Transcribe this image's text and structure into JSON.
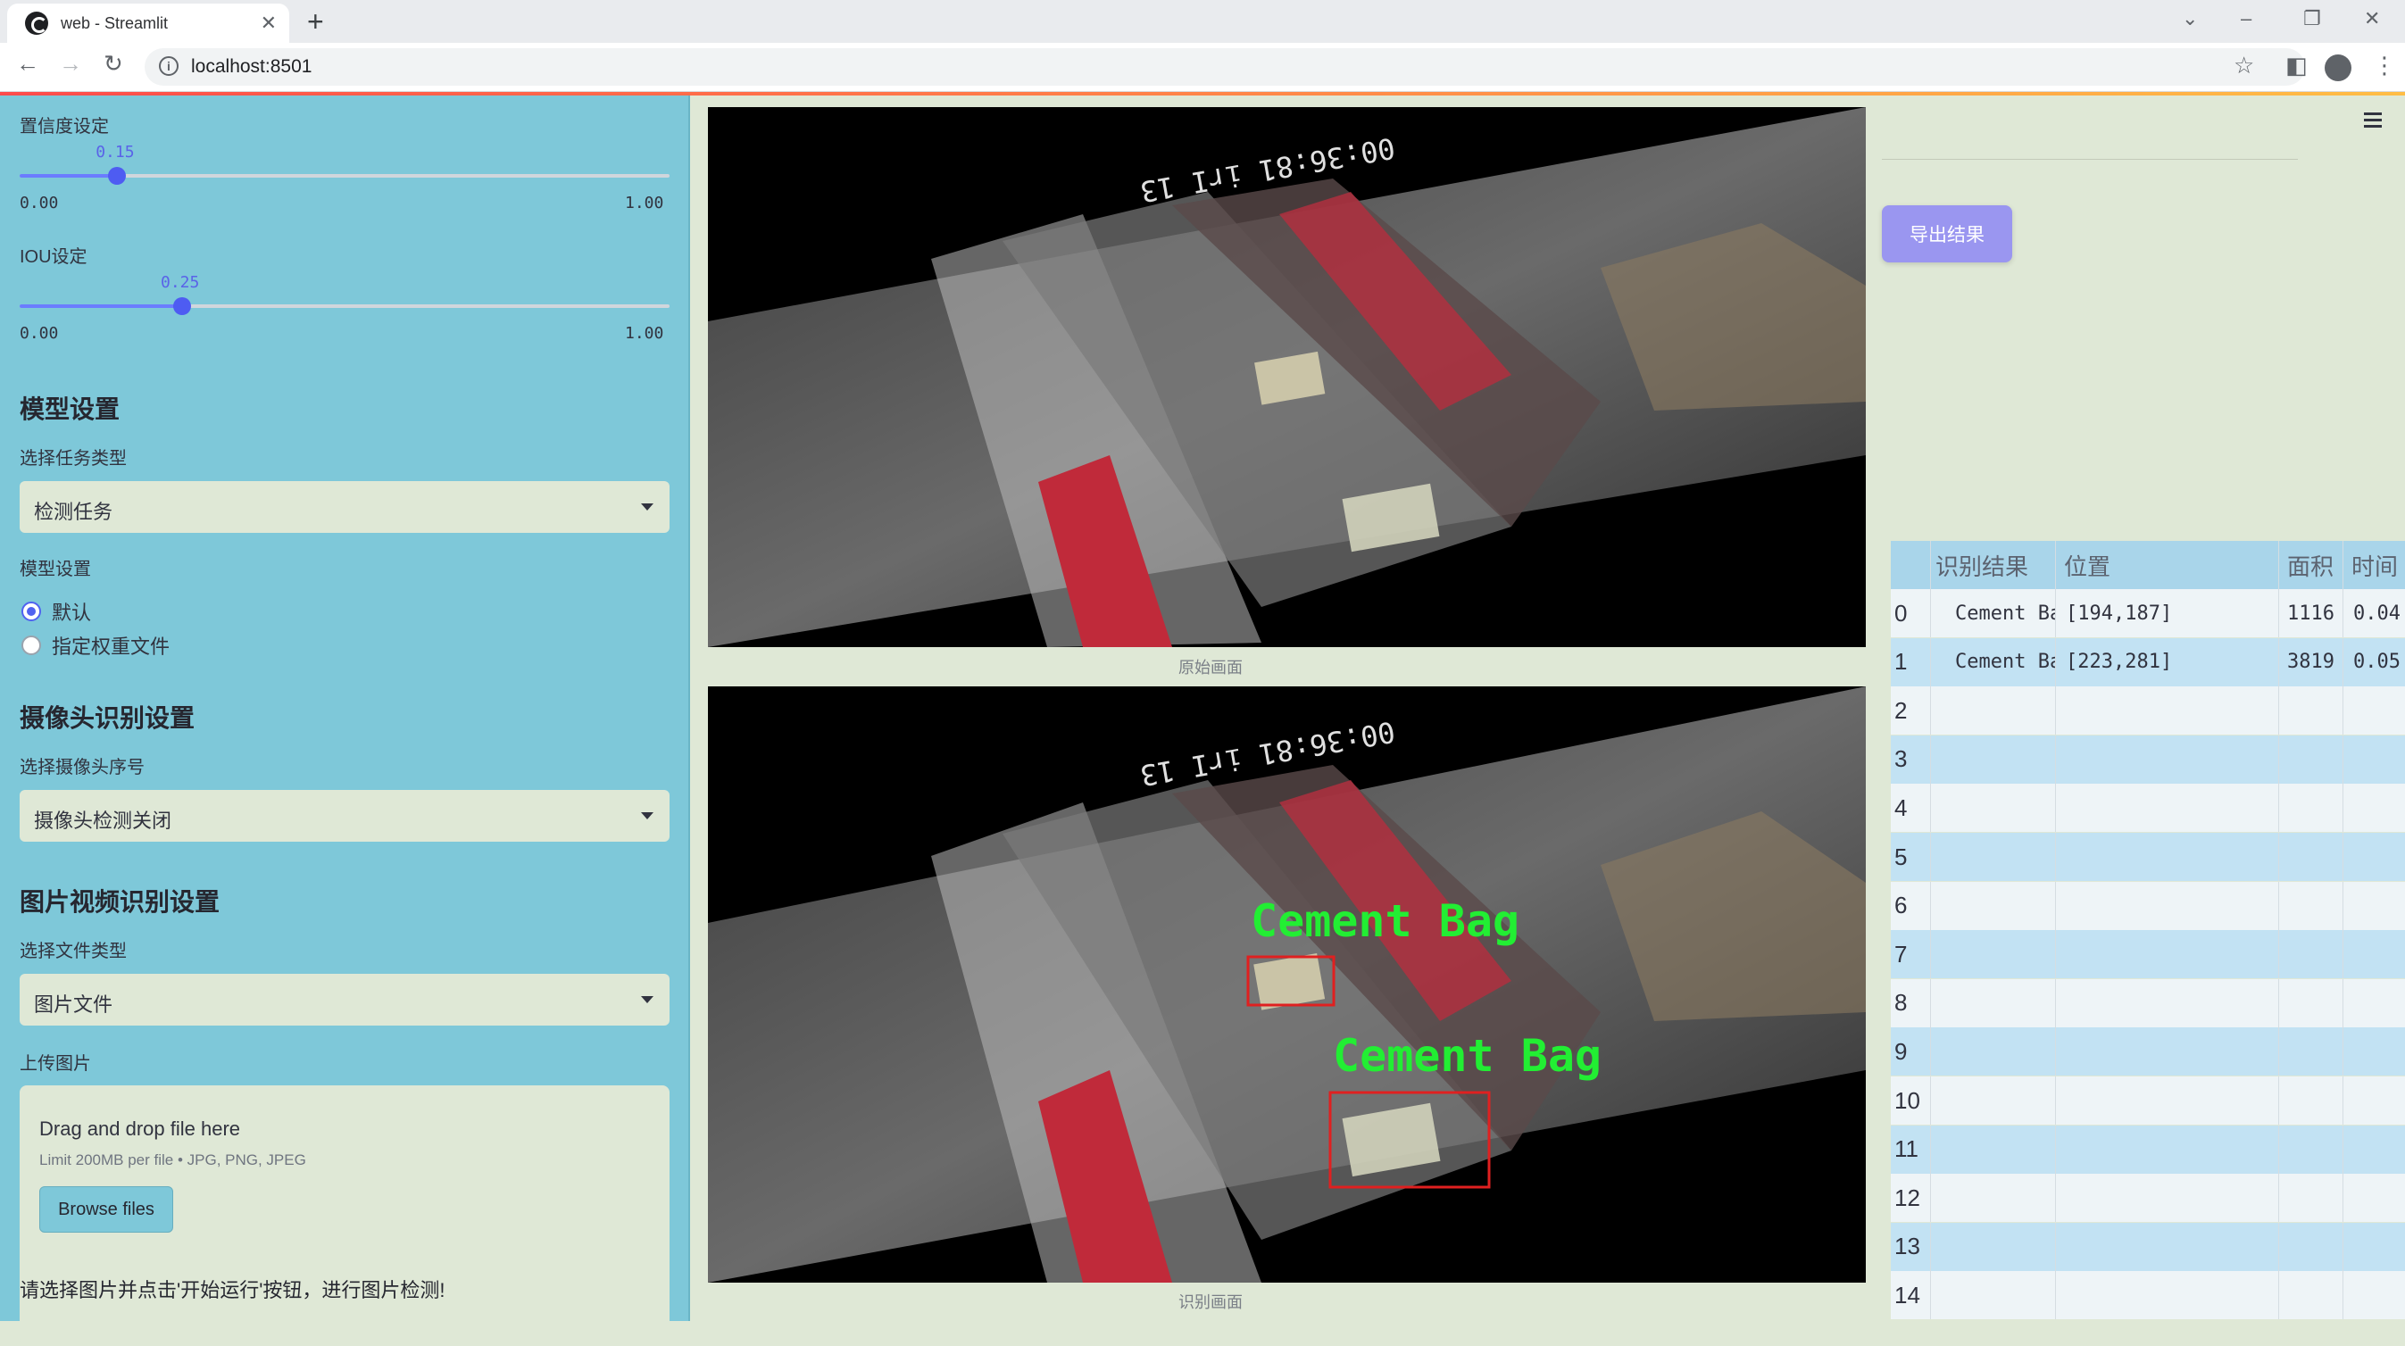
{
  "browser": {
    "tab_title": "web - Streamlit",
    "new_tab": "+",
    "url": "localhost:8501"
  },
  "sidebar": {
    "conf_label": "置信度设定",
    "conf_value": "0.15",
    "conf_min": "0.00",
    "conf_max": "1.00",
    "conf_fraction": 0.15,
    "iou_label": "IOU设定",
    "iou_value": "0.25",
    "iou_min": "0.00",
    "iou_max": "1.00",
    "iou_fraction": 0.25,
    "model_heading": "模型设置",
    "task_label": "选择任务类型",
    "task_value": "检测任务",
    "model_label": "模型设置",
    "radio_default": "默认",
    "radio_custom": "指定权重文件",
    "camera_heading": "摄像头识别设置",
    "camera_label": "选择摄像头序号",
    "camera_value": "摄像头检测关闭",
    "media_heading": "图片视频识别设置",
    "filetype_label": "选择文件类型",
    "filetype_value": "图片文件",
    "upload_label": "上传图片",
    "drag_text": "Drag and drop file here",
    "limit_text": "Limit 200MB per file • JPG, PNG, JPEG",
    "browse_label": "Browse files",
    "hint": "请选择图片并点击'开始运行'按钮，进行图片检测!"
  },
  "main": {
    "original_caption": "原始画面",
    "result_caption": "识别画面",
    "timestamp": "00:36:81 irI 13",
    "export_label": "导出结果",
    "detections": [
      {
        "label": "Cement Bag"
      },
      {
        "label": "Cement Bag"
      }
    ]
  },
  "table": {
    "headers": [
      "",
      "识别结果",
      "位置",
      "面积",
      "时间"
    ],
    "rows": [
      [
        "0",
        "Cement Bag",
        "[194,187]",
        "1116",
        "0.04"
      ],
      [
        "1",
        "Cement Bag",
        "[223,281]",
        "3819",
        "0.05"
      ],
      [
        "2",
        "",
        "",
        "",
        ""
      ],
      [
        "3",
        "",
        "",
        "",
        ""
      ],
      [
        "4",
        "",
        "",
        "",
        ""
      ],
      [
        "5",
        "",
        "",
        "",
        ""
      ],
      [
        "6",
        "",
        "",
        "",
        ""
      ],
      [
        "7",
        "",
        "",
        "",
        ""
      ],
      [
        "8",
        "",
        "",
        "",
        ""
      ],
      [
        "9",
        "",
        "",
        "",
        ""
      ],
      [
        "10",
        "",
        "",
        "",
        ""
      ],
      [
        "11",
        "",
        "",
        "",
        ""
      ],
      [
        "12",
        "",
        "",
        "",
        ""
      ],
      [
        "13",
        "",
        "",
        "",
        ""
      ],
      [
        "14",
        "",
        "",
        "",
        ""
      ]
    ]
  },
  "colors": {
    "sidebar_bg": "#7ec8d9",
    "main_bg": "#dfe8d6",
    "accent": "#4e5cf2",
    "export_button": "#9a96f0",
    "detection_text": "#22ee33",
    "detection_box": "#e02020"
  }
}
